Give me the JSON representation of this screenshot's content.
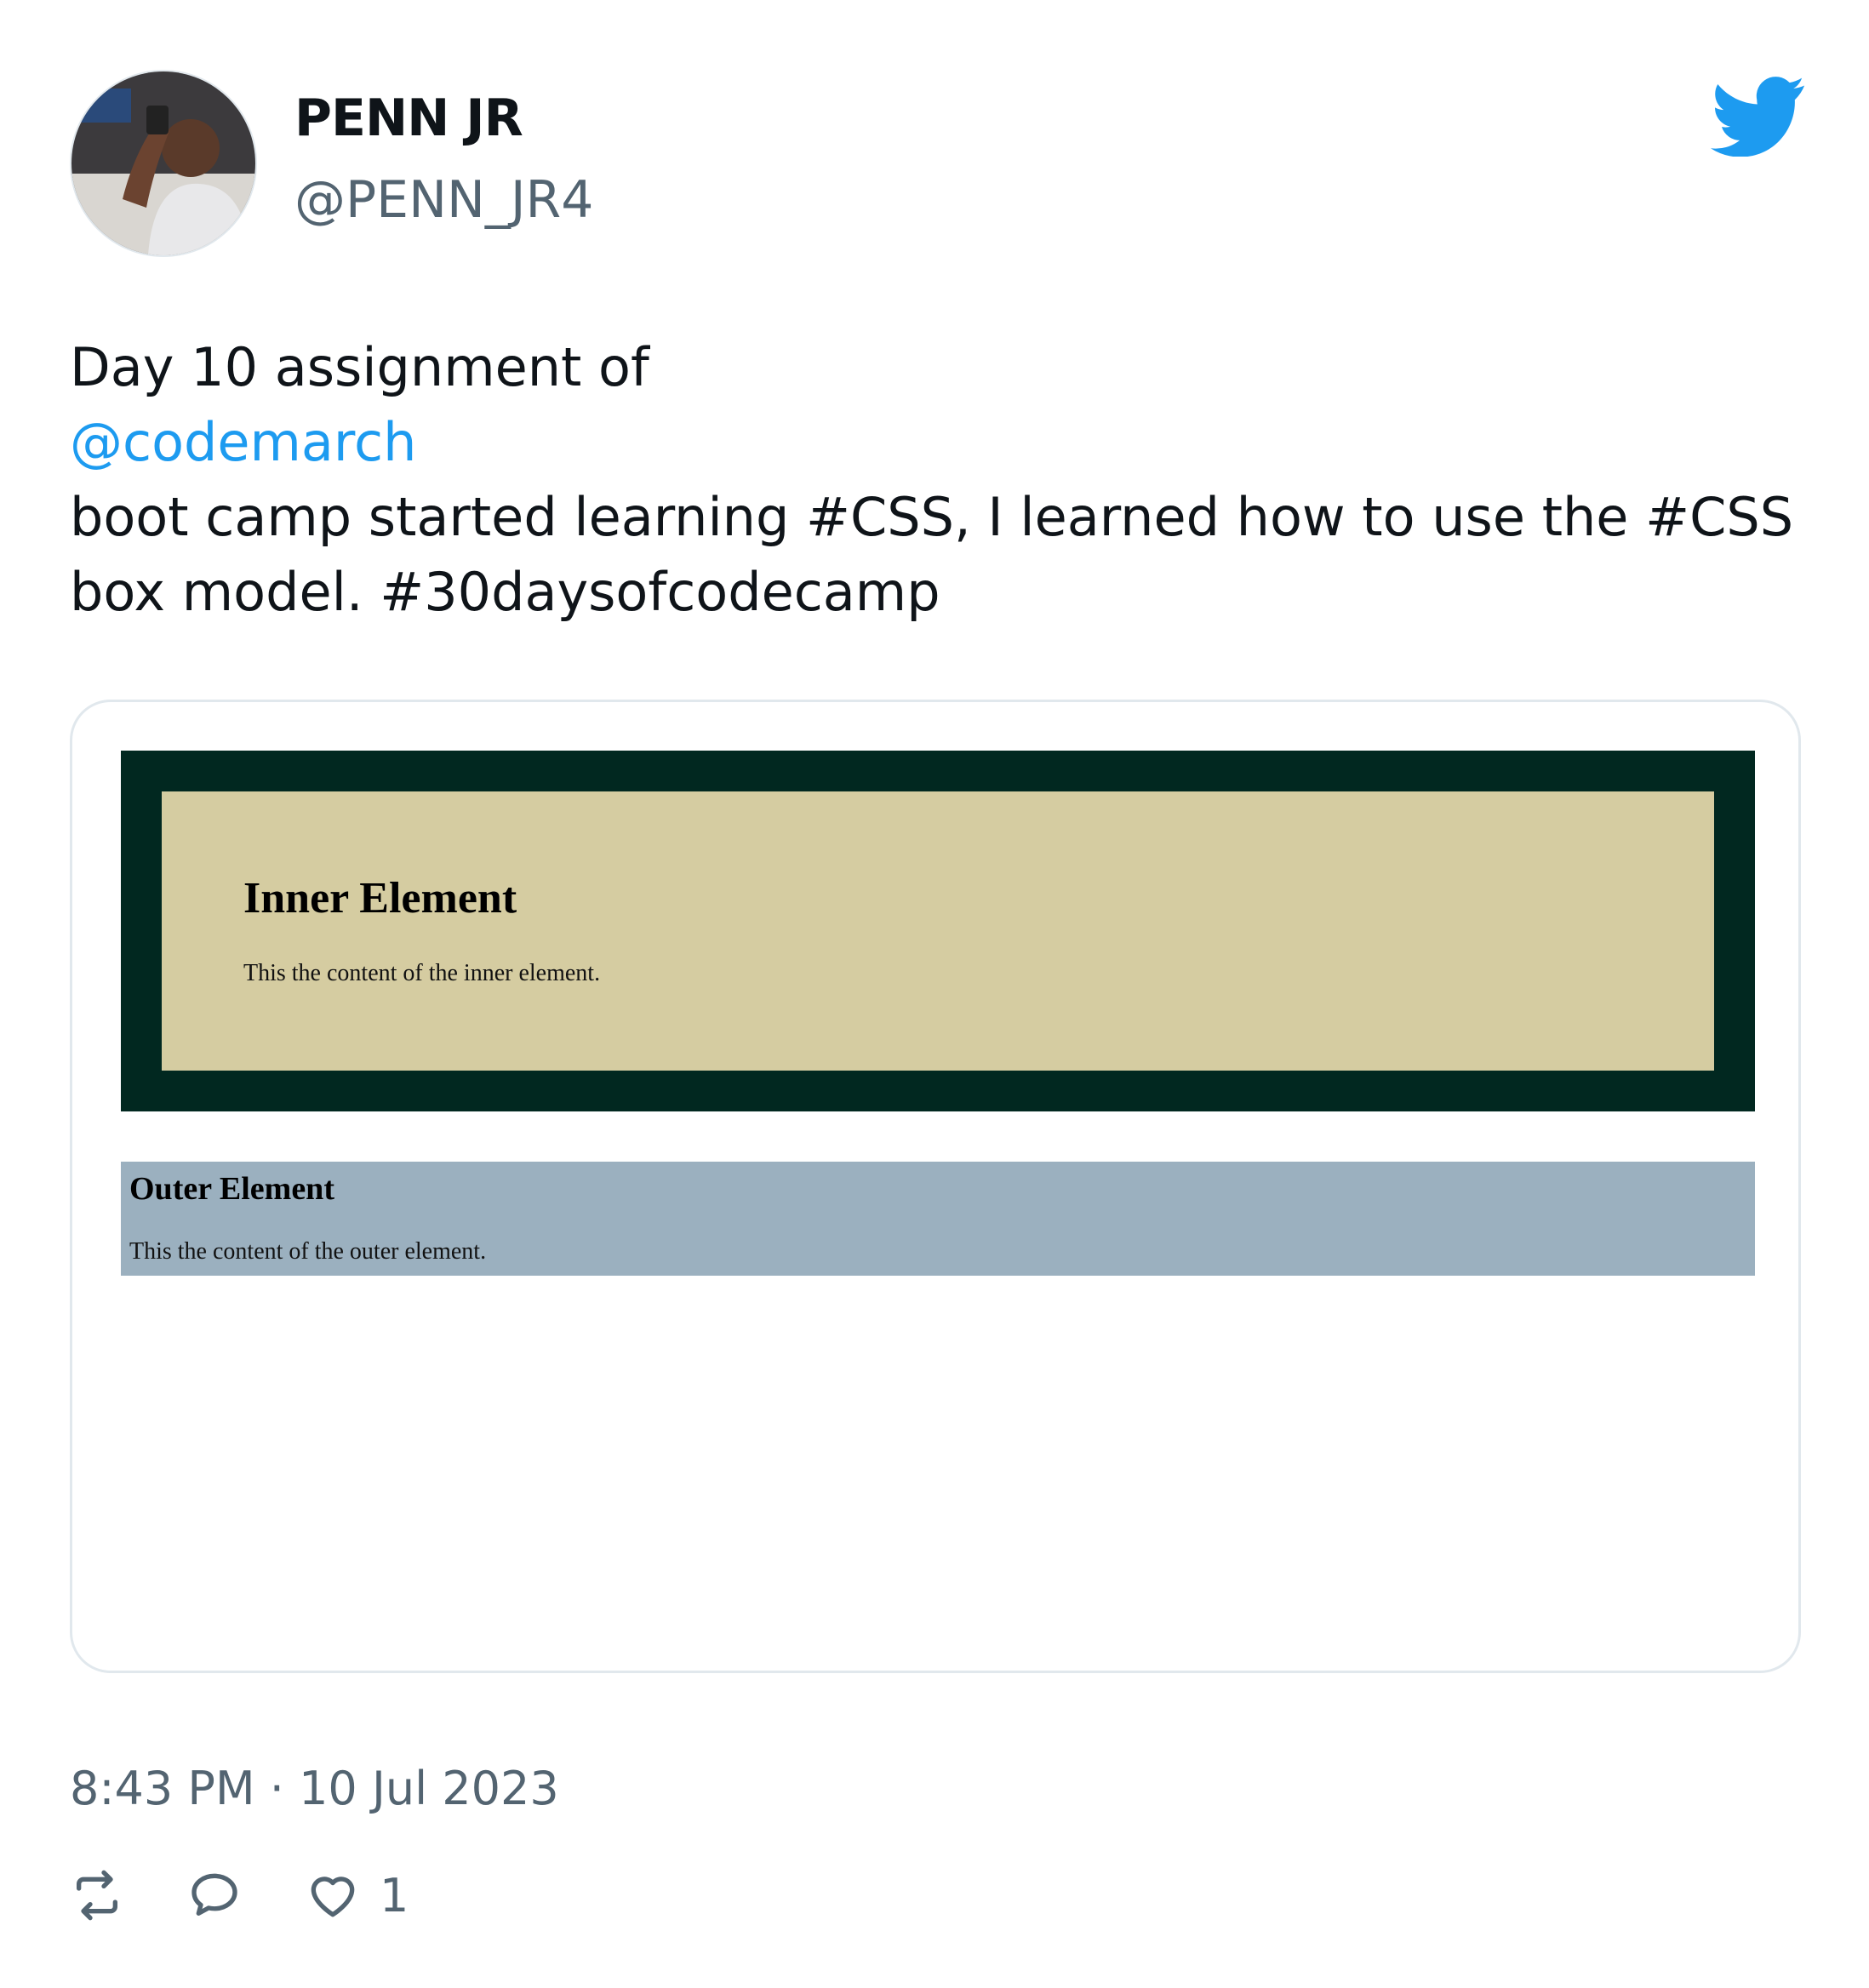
{
  "author": {
    "name": "PENN JR",
    "handle": "@PENN_JR4"
  },
  "tweet": {
    "line1": "Day 10 assignment of",
    "mention": "@codemarch",
    "line3": "boot camp started learning #CSS, I learned how to use the #CSS",
    "line4": "box model. #30daysofcodecamp"
  },
  "media": {
    "inner_title": "Inner Element",
    "inner_text": "This the content of the inner element.",
    "outer_title": "Outer Element",
    "outer_text": "This the content of the outer element.",
    "colors": {
      "outer_border": "#012820",
      "inner_background": "#d5cca1",
      "outer_section_background": "#9bb0bf"
    }
  },
  "timestamp": "8:43 PM · 10 Jul 2023",
  "actions": {
    "retweet_icon": "retweet-icon",
    "reply_icon": "reply-icon",
    "like_icon": "heart-icon",
    "like_count": "1"
  },
  "brand": {
    "logo_icon": "twitter-bird-icon",
    "accent_color": "#1d9bf0"
  }
}
